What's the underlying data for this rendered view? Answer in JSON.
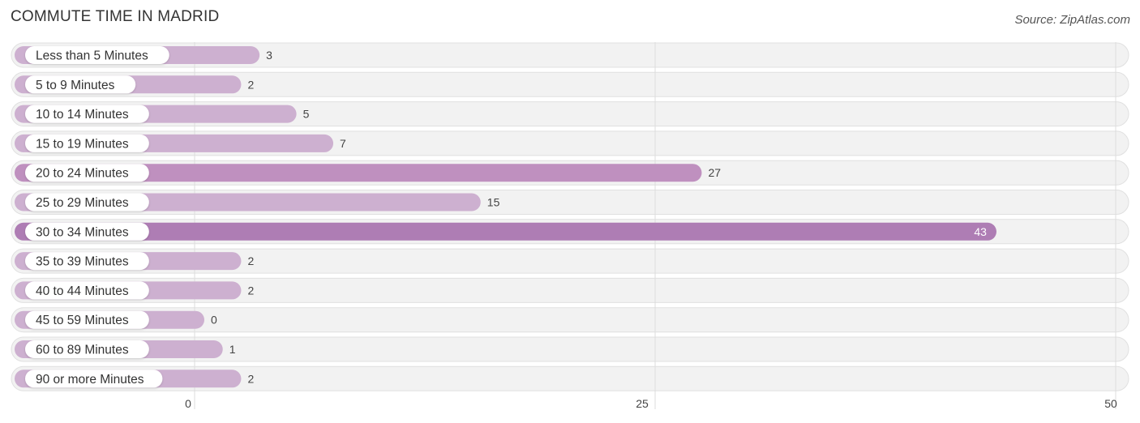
{
  "header": {
    "title": "COMMUTE TIME IN MADRID",
    "source": "Source: ZipAtlas.com"
  },
  "colors": {
    "bar_light": "#cdb0d0",
    "bar_medium": "#bf90bf",
    "bar_dark": "#ae7db4",
    "track": "#f2f2f2",
    "grid": "#dddddd"
  },
  "chart_data": {
    "type": "bar",
    "orientation": "horizontal",
    "title": "COMMUTE TIME IN MADRID",
    "xlabel": "",
    "ylabel": "",
    "categories": [
      "Less than 5 Minutes",
      "5 to 9 Minutes",
      "10 to 14 Minutes",
      "15 to 19 Minutes",
      "20 to 24 Minutes",
      "25 to 29 Minutes",
      "30 to 34 Minutes",
      "35 to 39 Minutes",
      "40 to 44 Minutes",
      "45 to 59 Minutes",
      "60 to 89 Minutes",
      "90 or more Minutes"
    ],
    "values": [
      3,
      2,
      5,
      7,
      27,
      15,
      43,
      2,
      2,
      0,
      1,
      2
    ],
    "xlim": [
      0,
      50
    ],
    "xticks": [
      0,
      25,
      50
    ],
    "grid": true,
    "legend": "none"
  }
}
